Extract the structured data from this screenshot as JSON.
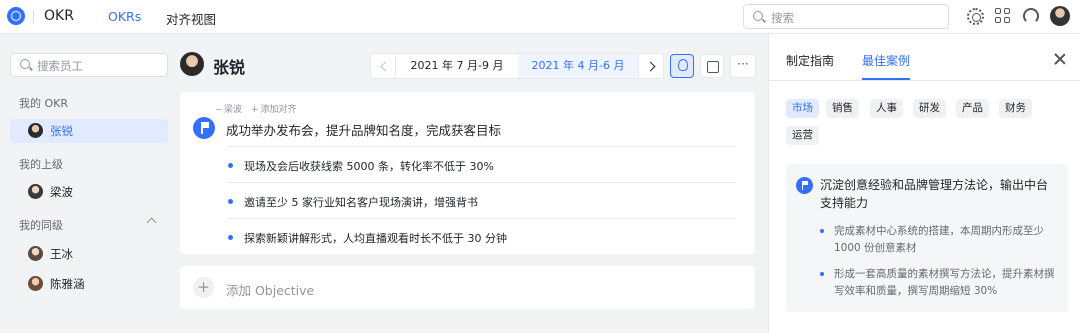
{
  "header": {
    "app_title": "OKR",
    "nav": [
      "OKRs",
      "对齐视图"
    ],
    "search_placeholder": "搜索"
  },
  "sidebar": {
    "search_placeholder": "搜索员工",
    "sections": [
      {
        "title": "我的 OKR",
        "items": [
          "张锐"
        ]
      },
      {
        "title": "我的上级",
        "items": [
          "梁波"
        ]
      },
      {
        "title": "我的同级",
        "items": [
          "王冰",
          "陈雅涵"
        ]
      }
    ]
  },
  "main": {
    "user_name": "张锐",
    "periods": [
      "2021 年 7 月-9 月",
      "2021 年 4 月-6 月"
    ],
    "align": {
      "owner": "梁波",
      "add": "添加对齐"
    },
    "objective": "成功举办发布会，提升品牌知名度，完成获客目标",
    "key_results": [
      "现场及会后收获线索 5000 条，转化率不低于 30%",
      "邀请至少 5 家行业知名客户现场演讲，增强背书",
      "探索新颖讲解形式，人均直播观看时长不低于 30 分钟"
    ],
    "add_objective": "添加 Objective",
    "add_plus": "+",
    "more": "···"
  },
  "right_panel": {
    "tabs": [
      "制定指南",
      "最佳案例"
    ],
    "tags": [
      "市场",
      "销售",
      "人事",
      "研发",
      "产品",
      "财务",
      "运营"
    ],
    "case": {
      "title": "沉淀创意经验和品牌管理方法论，输出中台支持能力",
      "key_results": [
        "完成素材中心系统的搭建，本周期内形成至少 1000 份创意素材",
        "形成一套高质量的素材撰写方法论，提升素材撰写效率和质量，撰写周期缩短 30%"
      ]
    }
  },
  "colors": {
    "accent": "#3370ff",
    "background": "#f2f3f5"
  }
}
